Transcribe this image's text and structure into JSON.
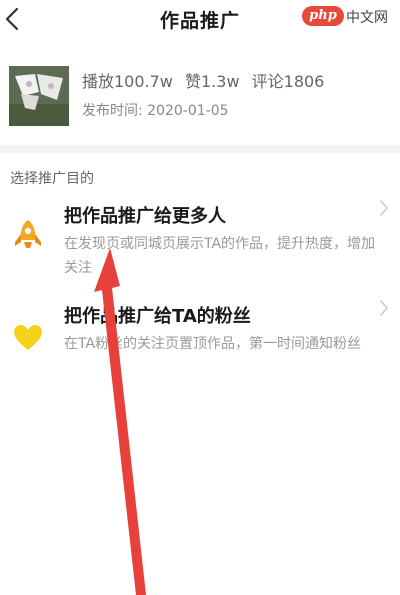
{
  "header": {
    "title": "作品推广"
  },
  "watermark": {
    "logo": "php",
    "text": "中文网"
  },
  "video": {
    "stats": [
      "播放100.7w",
      "赞1.3w",
      "评论1806"
    ],
    "publish_time": "发布时间:  2020-01-05"
  },
  "section": {
    "label": "选择推广目的"
  },
  "options": [
    {
      "title": "把作品推广给更多人",
      "desc": "在发现页或同城页展示TA的作品，提升热度，增加关注",
      "icon": "rocket-icon",
      "icon_color": "#f5a623"
    },
    {
      "title": "把作品推广给TA的粉丝",
      "desc": "在TA粉丝的关注页置顶作品，第一时间通知粉丝",
      "icon": "heart-icon",
      "icon_color": "#f7d21a"
    }
  ],
  "colors": {
    "annotation_arrow": "#e8403a"
  }
}
